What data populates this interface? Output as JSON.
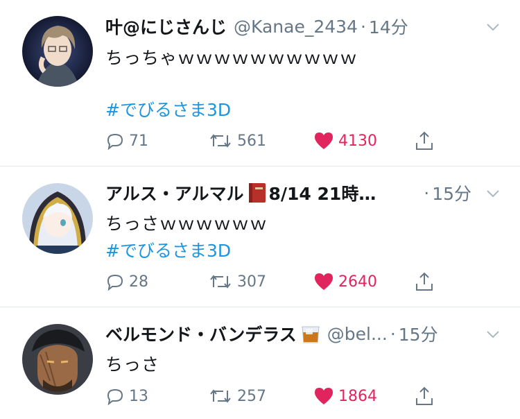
{
  "tweets": [
    {
      "name": "叶@にじさんじ",
      "handle": "@Kanae_2434",
      "dot": "·",
      "time": "14分",
      "text": "ちっちゃｗｗｗｗｗｗｗｗｗｗ",
      "hashtag": "#でびるさま3D",
      "replies": "71",
      "retweets": "561",
      "likes": "4130"
    },
    {
      "name": "アルス・アルマル",
      "name_suffix": "8/14 21時…",
      "dot": "·",
      "time": "15分",
      "text": "ちっさｗｗｗｗｗｗ",
      "hashtag": "#でびるさま3D",
      "replies": "28",
      "retweets": "307",
      "likes": "2640"
    },
    {
      "name": "ベルモンド・バンデラス",
      "handle": "@bel...",
      "dot": "·",
      "time": "15分",
      "text": "ちっさ",
      "replies": "13",
      "retweets": "257",
      "likes": "1864"
    }
  ],
  "icons": {
    "reply": "reply-icon",
    "retweet": "retweet-icon",
    "like": "heart-icon",
    "share": "share-icon",
    "caret": "chevron-down-icon"
  },
  "colors": {
    "text": "#14171a",
    "secondary": "#657786",
    "link": "#1b95e0",
    "like": "#e0245e",
    "divider": "#e1e8ed"
  }
}
